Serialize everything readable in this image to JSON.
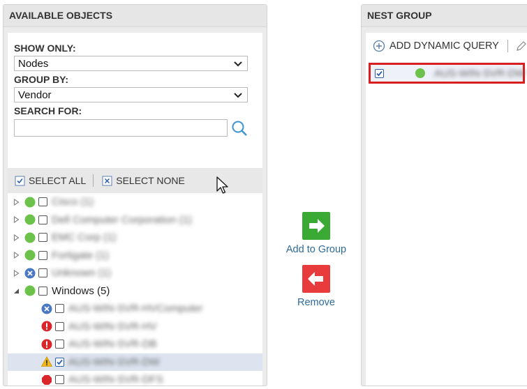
{
  "left_panel": {
    "title": "AVAILABLE OBJECTS",
    "show_only_label": "SHOW ONLY:",
    "show_only_value": "Nodes",
    "group_by_label": "GROUP BY:",
    "group_by_value": "Vendor",
    "search_label": "SEARCH FOR:",
    "search_value": "",
    "select_all": "SELECT ALL",
    "select_none": "SELECT NONE",
    "tree": [
      {
        "label": "Cisco (1)",
        "status": "up",
        "expander": "collapsed",
        "checked": false,
        "blurred": true
      },
      {
        "label": "Dell Computer Corporation (1)",
        "status": "up",
        "expander": "collapsed",
        "checked": false,
        "blurred": true
      },
      {
        "label": "EMC Corp (1)",
        "status": "up",
        "expander": "collapsed",
        "checked": false,
        "blurred": true
      },
      {
        "label": "Fortigate (1)",
        "status": "up",
        "expander": "collapsed",
        "checked": false,
        "blurred": true
      },
      {
        "label": "Unknown (1)",
        "status": "unknown",
        "expander": "collapsed",
        "checked": false,
        "blurred": true
      },
      {
        "label": "Windows (5)",
        "status": "up",
        "expander": "expanded",
        "checked": false,
        "blurred": false
      },
      {
        "label": "AUS-WIN-SVR-HVComputer",
        "status": "unknown",
        "expander": "none",
        "checked": false,
        "blurred": true,
        "child": true
      },
      {
        "label": "AUS-WIN-SVR-HV",
        "status": "critical",
        "expander": "none",
        "checked": false,
        "blurred": true,
        "child": true
      },
      {
        "label": "AUS-WIN-SVR-DB",
        "status": "critical",
        "expander": "none",
        "checked": false,
        "blurred": true,
        "child": true
      },
      {
        "label": "AUS-WIN-SVR-DW",
        "status": "warning",
        "expander": "none",
        "checked": true,
        "blurred": true,
        "child": true,
        "selected": true
      },
      {
        "label": "AUS-WIN-SVR-DFS",
        "status": "down",
        "expander": "none",
        "checked": false,
        "blurred": true,
        "child": true
      }
    ]
  },
  "transfer": {
    "add_label": "Add to Group",
    "remove_label": "Remove"
  },
  "right_panel": {
    "title": "NEST GROUP",
    "add_dynamic_query": "ADD DYNAMIC QUERY",
    "group_item_label": "AUS-WIN-SVR-DW",
    "group_item_checked": true
  },
  "colors": {
    "status_up": "#6cc24a",
    "status_critical": "#d9262a",
    "status_unknown": "#4a78c2",
    "status_warning": "#f2b81c",
    "add_button": "#3aaa35",
    "remove_button": "#e83c3c",
    "highlight_border": "#d81e1e"
  }
}
